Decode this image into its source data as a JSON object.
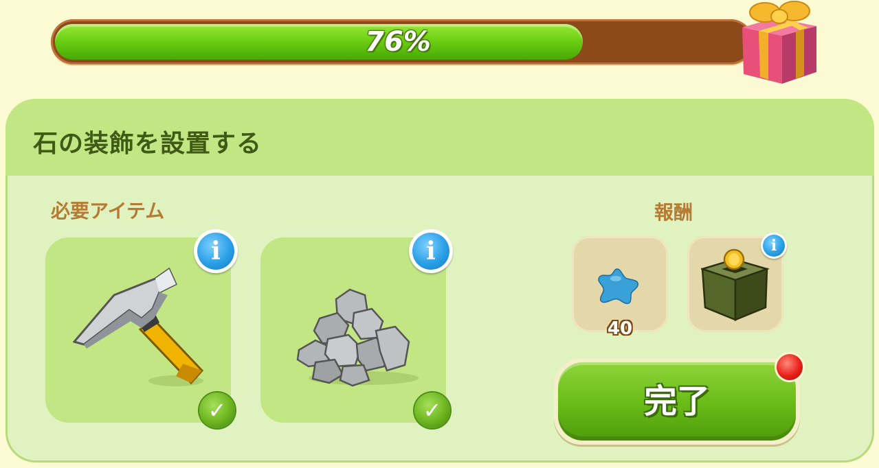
{
  "progress": {
    "value": 0.76,
    "label": "76%"
  },
  "panel": {
    "title": "石の装飾を設置する",
    "required_label": "必要アイテム",
    "reward_label": "報酬"
  },
  "required_items": [
    {
      "icon": "hammer-icon",
      "info_glyph": "i",
      "check_glyph": "✓"
    },
    {
      "icon": "stone-pile-icon",
      "info_glyph": "i",
      "check_glyph": "✓"
    }
  ],
  "rewards": [
    {
      "icon": "blue-star-icon",
      "count": "40"
    },
    {
      "icon": "coin-box-icon",
      "info_glyph": "i"
    }
  ],
  "complete_button": {
    "label": "完了"
  },
  "colors": {
    "progress_fill": "#6dd012",
    "progress_track": "#8c4a1a",
    "panel_bg": "#e0f2bf",
    "header_bg": "#c3e685",
    "title_text": "#3e5a14",
    "section_label": "#b57a33",
    "button_green": "#6bbd1a",
    "notify_red": "#e8201a"
  }
}
